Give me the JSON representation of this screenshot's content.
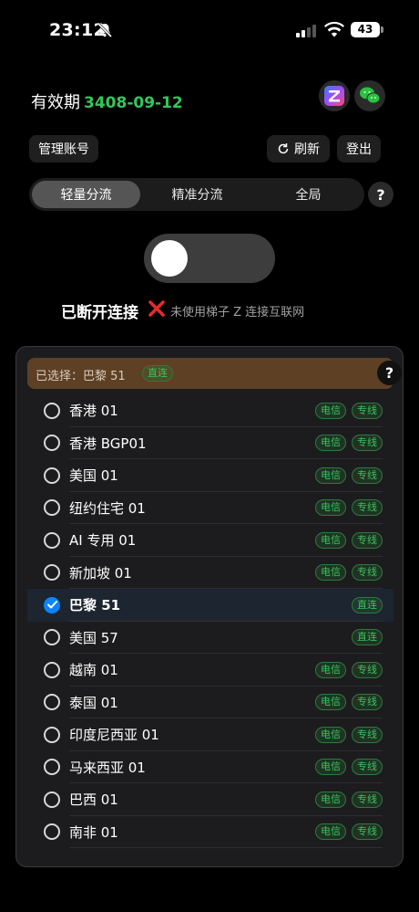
{
  "status": {
    "time": "23:12",
    "battery": "43"
  },
  "header": {
    "validity_label": "有效期",
    "validity_date": "3408-09-12"
  },
  "buttons": {
    "manage": "管理账号",
    "refresh": "刷新",
    "logout": "登出"
  },
  "modes": [
    "轻量分流",
    "精准分流",
    "全局"
  ],
  "help": "?",
  "connection": {
    "status": "已断开连接",
    "note": "未使用梯子 Z 连接互联网"
  },
  "panel": {
    "selected_label": "已选择：巴黎 51",
    "selected_tag": "直连",
    "help": "?"
  },
  "servers": [
    {
      "name": "香港 01",
      "tags": [
        "电信",
        "专线"
      ],
      "selected": false
    },
    {
      "name": "香港 BGP01",
      "tags": [
        "电信",
        "专线"
      ],
      "selected": false
    },
    {
      "name": "美国 01",
      "tags": [
        "电信",
        "专线"
      ],
      "selected": false
    },
    {
      "name": "纽约住宅 01",
      "tags": [
        "电信",
        "专线"
      ],
      "selected": false
    },
    {
      "name": "AI 专用 01",
      "tags": [
        "电信",
        "专线"
      ],
      "selected": false
    },
    {
      "name": "新加坡 01",
      "tags": [
        "电信",
        "专线"
      ],
      "selected": false
    },
    {
      "name": "巴黎 51",
      "tags": [
        "直连"
      ],
      "selected": true
    },
    {
      "name": "美国 57",
      "tags": [
        "直连"
      ],
      "selected": false
    },
    {
      "name": "越南 01",
      "tags": [
        "电信",
        "专线"
      ],
      "selected": false
    },
    {
      "name": "泰国 01",
      "tags": [
        "电信",
        "专线"
      ],
      "selected": false
    },
    {
      "name": "印度尼西亚 01",
      "tags": [
        "电信",
        "专线"
      ],
      "selected": false
    },
    {
      "name": "马来西亚 01",
      "tags": [
        "电信",
        "专线"
      ],
      "selected": false
    },
    {
      "name": "巴西 01",
      "tags": [
        "电信",
        "专线"
      ],
      "selected": false
    },
    {
      "name": "南非 01",
      "tags": [
        "电信",
        "专线"
      ],
      "selected": false
    }
  ],
  "colors": {
    "accent_green": "#34c759",
    "radio_blue": "#0a84ff",
    "selected_bar": "#5e4025"
  }
}
